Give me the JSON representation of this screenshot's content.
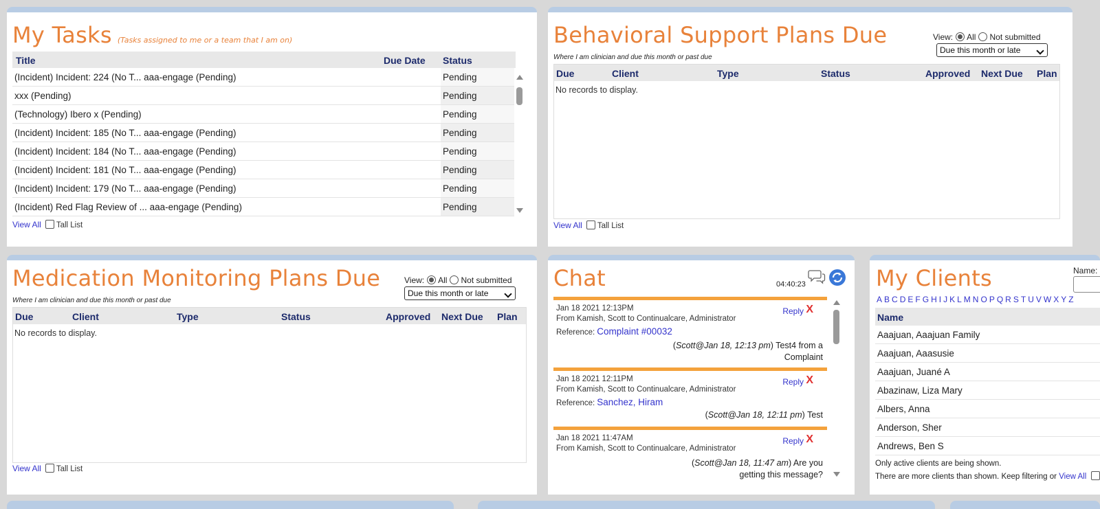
{
  "my_tasks": {
    "title": "My Tasks",
    "subtitle": "(Tasks assigned to me or a team that I am on)",
    "columns": {
      "title": "Title",
      "due_date": "Due Date",
      "status": "Status"
    },
    "rows": [
      {
        "title": "(Incident) Incident: 224 (No T... aaa-engage (Pending)",
        "status": "Pending"
      },
      {
        "title": "xxx (Pending)",
        "status": "Pending"
      },
      {
        "title": "(Technology) Ibero x (Pending)",
        "status": "Pending"
      },
      {
        "title": "(Incident) Incident: 185 (No T... aaa-engage (Pending)",
        "status": "Pending"
      },
      {
        "title": "(Incident) Incident: 184 (No T... aaa-engage (Pending)",
        "status": "Pending"
      },
      {
        "title": "(Incident) Incident: 181 (No T... aaa-engage (Pending)",
        "status": "Pending"
      },
      {
        "title": "(Incident) Incident: 179 (No T... aaa-engage (Pending)",
        "status": "Pending"
      },
      {
        "title": "(Incident) Red Flag Review of ... aaa-engage (Pending)",
        "status": "Pending"
      }
    ],
    "view_all": "View All",
    "tall_list": "Tall List"
  },
  "bsp": {
    "title": "Behavioral Support Plans Due",
    "subtitle": "Where I am clinician and due this month or past due",
    "view_label": "View:",
    "radio_all": "All",
    "radio_not_submitted": "Not submitted",
    "select_value": "Due this month or late",
    "columns": {
      "due": "Due",
      "client": "Client",
      "type": "Type",
      "status": "Status",
      "approved": "Approved",
      "next_due": "Next Due",
      "plan": "Plan"
    },
    "no_records": "No records to display.",
    "view_all": "View All",
    "tall_list": "Tall List"
  },
  "mmp": {
    "title": "Medication Monitoring Plans Due",
    "subtitle": "Where I am clinician and due this month or past due",
    "view_label": "View:",
    "radio_all": "All",
    "radio_not_submitted": "Not submitted",
    "select_value": "Due this month or late",
    "columns": {
      "due": "Due",
      "client": "Client",
      "type": "Type",
      "status": "Status",
      "approved": "Approved",
      "next_due": "Next Due",
      "plan": "Plan"
    },
    "no_records": "No records to display.",
    "view_all": "View All",
    "tall_list": "Tall List"
  },
  "chat": {
    "title": "Chat",
    "clock": "04:40:23",
    "messages": [
      {
        "timestamp": "Jan 18 2021 12:13PM",
        "from": "From Kamish, Scott to Continualcare, Administrator",
        "ref_label": "Reference:",
        "ref_link": "Complaint #00032",
        "reply": "Reply",
        "delete": "X",
        "author": "Scott@Jan 18, 12:13 pm",
        "text": "Test4 from a Complaint"
      },
      {
        "timestamp": "Jan 18 2021 12:11PM",
        "from": "From Kamish, Scott to Continualcare, Administrator",
        "ref_label": "Reference:",
        "ref_link": "Sanchez, Hiram",
        "reply": "Reply",
        "delete": "X",
        "author": "Scott@Jan 18, 12:11 pm",
        "text": "Test"
      },
      {
        "timestamp": "Jan 18 2021 11:47AM",
        "from": "From Kamish, Scott to Continualcare, Administrator",
        "reply": "Reply",
        "delete": "X",
        "author": "Scott@Jan 18, 11:47 am",
        "text": "Are you getting this message?"
      }
    ]
  },
  "clients": {
    "title": "My Clients",
    "name_label": "Name:",
    "letters": [
      "A",
      "B",
      "C",
      "D",
      "E",
      "F",
      "G",
      "H",
      "I",
      "J",
      "K",
      "L",
      "M",
      "N",
      "O",
      "P",
      "Q",
      "R",
      "S",
      "T",
      "U",
      "V",
      "W",
      "X",
      "Y",
      "Z"
    ],
    "column_name": "Name",
    "rows": [
      "Aaajuan, Aaajuan Family",
      "Aaajuan, Aaasusie",
      "Aaajuan, Juané A",
      "Abazinaw, Liza Mary",
      "Albers, Anna",
      "Anderson, Sher",
      "Andrews, Ben S"
    ],
    "note_active": "Only active clients are being shown.",
    "note_more": "There are more clients than shown. Keep filtering or",
    "view_all": "View All"
  },
  "colors": {
    "accent_orange": "#e8823a",
    "panel_border": "#b8cce4",
    "chat_bar": "#f4a23c",
    "link_blue": "#3333cc",
    "header_navy": "#1c2a6b"
  }
}
